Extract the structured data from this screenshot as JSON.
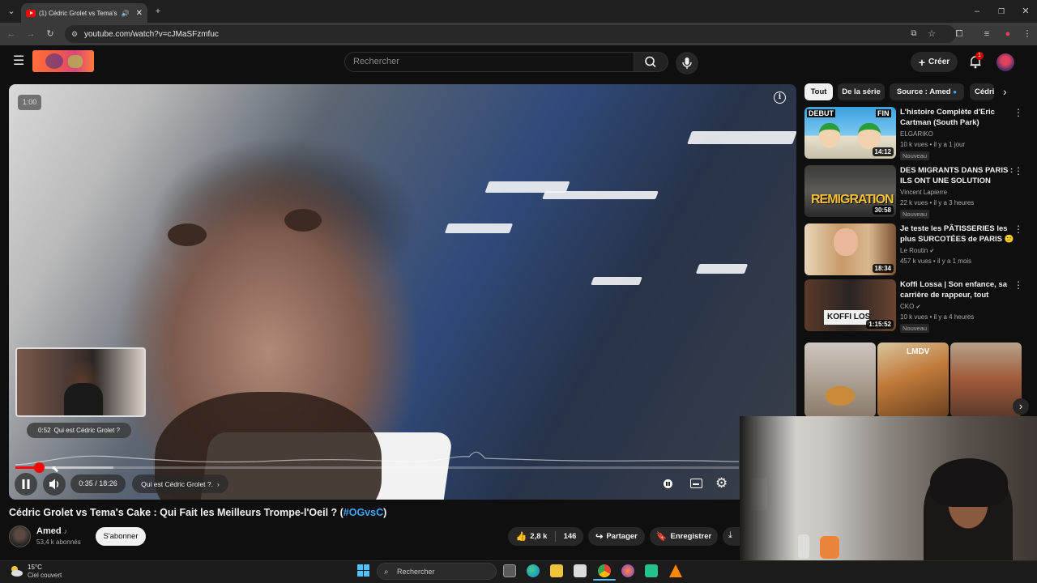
{
  "browser": {
    "tab_title": "(1) Cédric Grolet vs Tema's C",
    "url": "youtube.com/watch?v=cJMaSFzmfuc"
  },
  "header": {
    "search_placeholder": "Rechercher",
    "create_label": "Créer",
    "notification_count": "1"
  },
  "player": {
    "speed_badge": "1:00",
    "preview_time": "0:52",
    "preview_chapter": "Qui est Cédric Grolet ?",
    "time_display": "0:35 / 18:26",
    "chapter_label": "Qui est Cédric Grolet ?.",
    "progress_fraction": 0.032,
    "buffer_fraction": 0.135
  },
  "video": {
    "title_main": "Cédric Grolet vs Tema's Cake : Qui Fait les Meilleurs Trompe-l'Oeil ? (",
    "title_tag": "#OGvsC",
    "title_end": ")",
    "channel": "Amed",
    "subscribers": "53,4 k abonnés",
    "subscribe_label": "S'abonner",
    "likes": "2,8 k",
    "comments": "146",
    "share_label": "Partager",
    "save_label": "Enregistrer"
  },
  "sidebar": {
    "chips": [
      "Tout",
      "De la série",
      "Source : Amed",
      "Cédric"
    ],
    "recommendations": [
      {
        "title": "L'histoire Complète d'Eric Cartman (South Park)",
        "channel": "ELGARIKO",
        "meta": "10 k vues • il y a 1 jour",
        "badge": "Nouveau",
        "duration": "14:12",
        "thumb_text_1": "DEBUT",
        "thumb_text_2": "FIN"
      },
      {
        "title": "DES MIGRANTS DANS PARIS : ILS ONT UNE SOLUTION",
        "channel": "Vincent Lapierre",
        "meta": "22 k vues • il y a 3 heures",
        "badge": "Nouveau",
        "duration": "30:58",
        "thumb_text_1": "REMIGRATION"
      },
      {
        "title": "Je teste les PÂTISSERIES les plus SURCOTÉES de PARIS 😕",
        "channel": "Le Routin",
        "meta": "457 k vues • il y a 1 mois",
        "badge": "",
        "duration": "18:34"
      },
      {
        "title": "Koffi Lossa | Son enfance, sa carrière de rappeur, tout arrête...",
        "channel": "CKO",
        "meta": "10 k vues • il y a 4 heures",
        "badge": "Nouveau",
        "duration": "1:15:52",
        "thumb_text_1": "KOFFI LOS"
      }
    ],
    "short_label": "LMDV"
  },
  "taskbar": {
    "temperature": "15°C",
    "weather": "Ciel couvert",
    "search_placeholder": "Rechercher"
  },
  "colors": {
    "accent_red": "#ff0000",
    "link_blue": "#3ea6ff",
    "bg": "#0f0f0f"
  }
}
